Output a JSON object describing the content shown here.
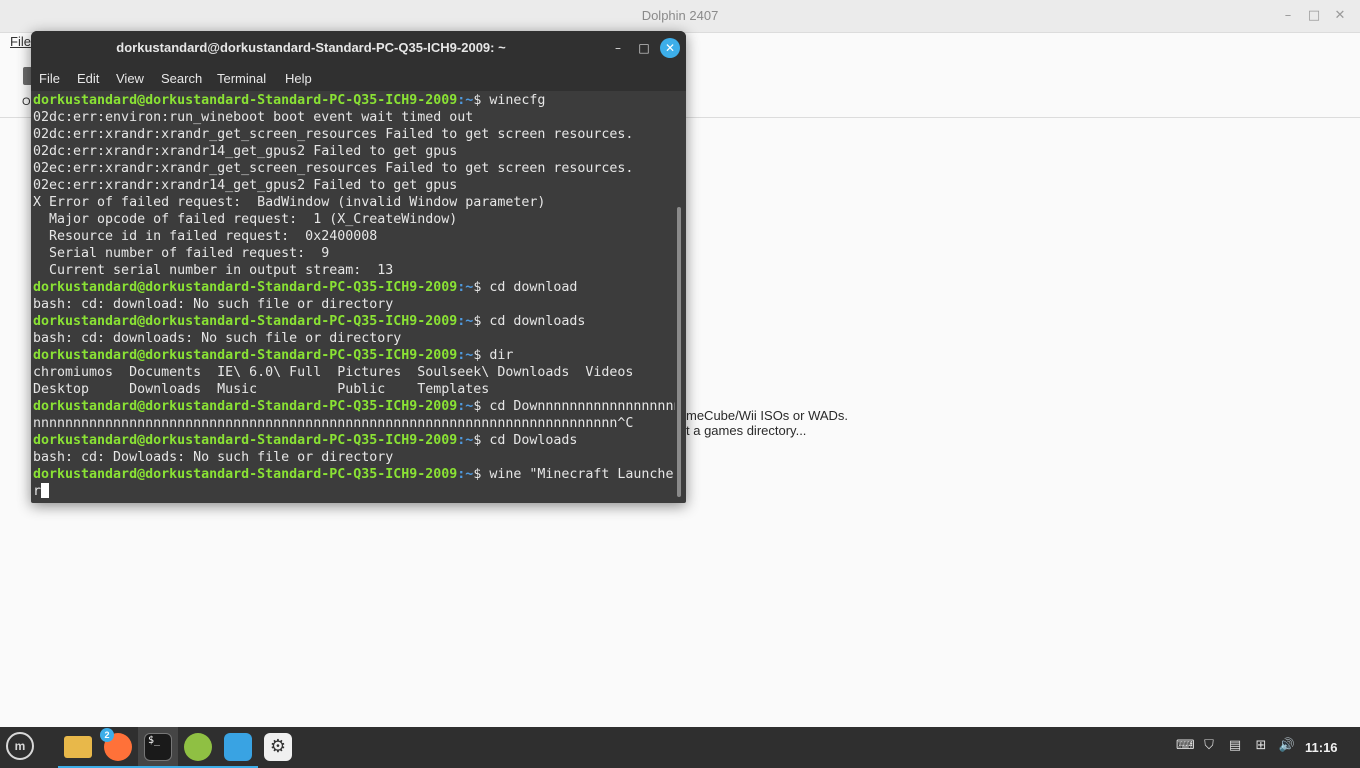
{
  "dolphin": {
    "title": "Dolphin 2407",
    "menu_file": "File",
    "toolbar_fragment_label": "O",
    "empty_line_1": "meCube/Wii ISOs or WADs.",
    "empty_line_2": "t a games directory..."
  },
  "terminal": {
    "title": "dorkustandard@dorkustandard-Standard-PC-Q35-ICH9-2009: ~",
    "menus": [
      "File",
      "Edit",
      "View",
      "Search",
      "Terminal",
      "Help"
    ],
    "prompt_user": "dorkustandard@dorkustandard-Standard-PC-Q35-ICH9-2009",
    "prompt_path": ":~",
    "lines": [
      {
        "type": "prompt",
        "cmd": "$ winecfg"
      },
      {
        "type": "out",
        "text": "02dc:err:environ:run_wineboot boot event wait timed out"
      },
      {
        "type": "out",
        "text": "02dc:err:xrandr:xrandr_get_screen_resources Failed to get screen resources."
      },
      {
        "type": "out",
        "text": "02dc:err:xrandr:xrandr14_get_gpus2 Failed to get gpus"
      },
      {
        "type": "out",
        "text": "02ec:err:xrandr:xrandr_get_screen_resources Failed to get screen resources."
      },
      {
        "type": "out",
        "text": "02ec:err:xrandr:xrandr14_get_gpus2 Failed to get gpus"
      },
      {
        "type": "out",
        "text": "X Error of failed request:  BadWindow (invalid Window parameter)"
      },
      {
        "type": "out",
        "text": "  Major opcode of failed request:  1 (X_CreateWindow)"
      },
      {
        "type": "out",
        "text": "  Resource id in failed request:  0x2400008"
      },
      {
        "type": "out",
        "text": "  Serial number of failed request:  9"
      },
      {
        "type": "out",
        "text": "  Current serial number in output stream:  13"
      },
      {
        "type": "prompt",
        "cmd": "$ cd download"
      },
      {
        "type": "out",
        "text": "bash: cd: download: No such file or directory"
      },
      {
        "type": "prompt",
        "cmd": "$ cd downloads"
      },
      {
        "type": "out",
        "text": "bash: cd: downloads: No such file or directory"
      },
      {
        "type": "prompt",
        "cmd": "$ dir"
      },
      {
        "type": "out",
        "text": "chromiumos  Documents  IE\\ 6.0\\ Full  Pictures  Soulseek\\ Downloads  Videos"
      },
      {
        "type": "out",
        "text": "Desktop     Downloads  Music          Public    Templates"
      },
      {
        "type": "prompt",
        "cmd": "$ cd Downnnnnnnnnnnnnnnnnn"
      },
      {
        "type": "out",
        "text": "nnnnnnnnnnnnnnnnnnnnnnnnnnnnnnnnnnnnnnnnnnnnnnnnnnnnnnnnnnnnnnnnnnnnnnnnn^C"
      },
      {
        "type": "prompt",
        "cmd": "$ cd Dowloads"
      },
      {
        "type": "out",
        "text": "bash: cd: Dowloads: No such file or directory"
      },
      {
        "type": "prompt",
        "cmd": "$ wine \"Minecraft Launche"
      },
      {
        "type": "out",
        "text": "r",
        "cursor": true
      }
    ]
  },
  "taskbar": {
    "menu_icon": "mint-menu-icon",
    "apps": [
      {
        "name": "files-icon",
        "color": "#e8b84a"
      },
      {
        "name": "firefox-icon",
        "color": "#ff7139",
        "badge": "2"
      },
      {
        "name": "terminal-icon",
        "color": "#1a1a1a",
        "glyph": "$_"
      },
      {
        "name": "calculator-icon",
        "color": "#8fc043"
      },
      {
        "name": "dolphin-emulator-icon",
        "color": "#39a3e3"
      },
      {
        "name": "settings-icon",
        "color": "#f0f0f0"
      }
    ],
    "tray_icons": [
      "keyboard-layout-icon",
      "shield-icon",
      "clipboard-icon",
      "network-icon",
      "volume-icon"
    ],
    "clock": "11:16"
  }
}
